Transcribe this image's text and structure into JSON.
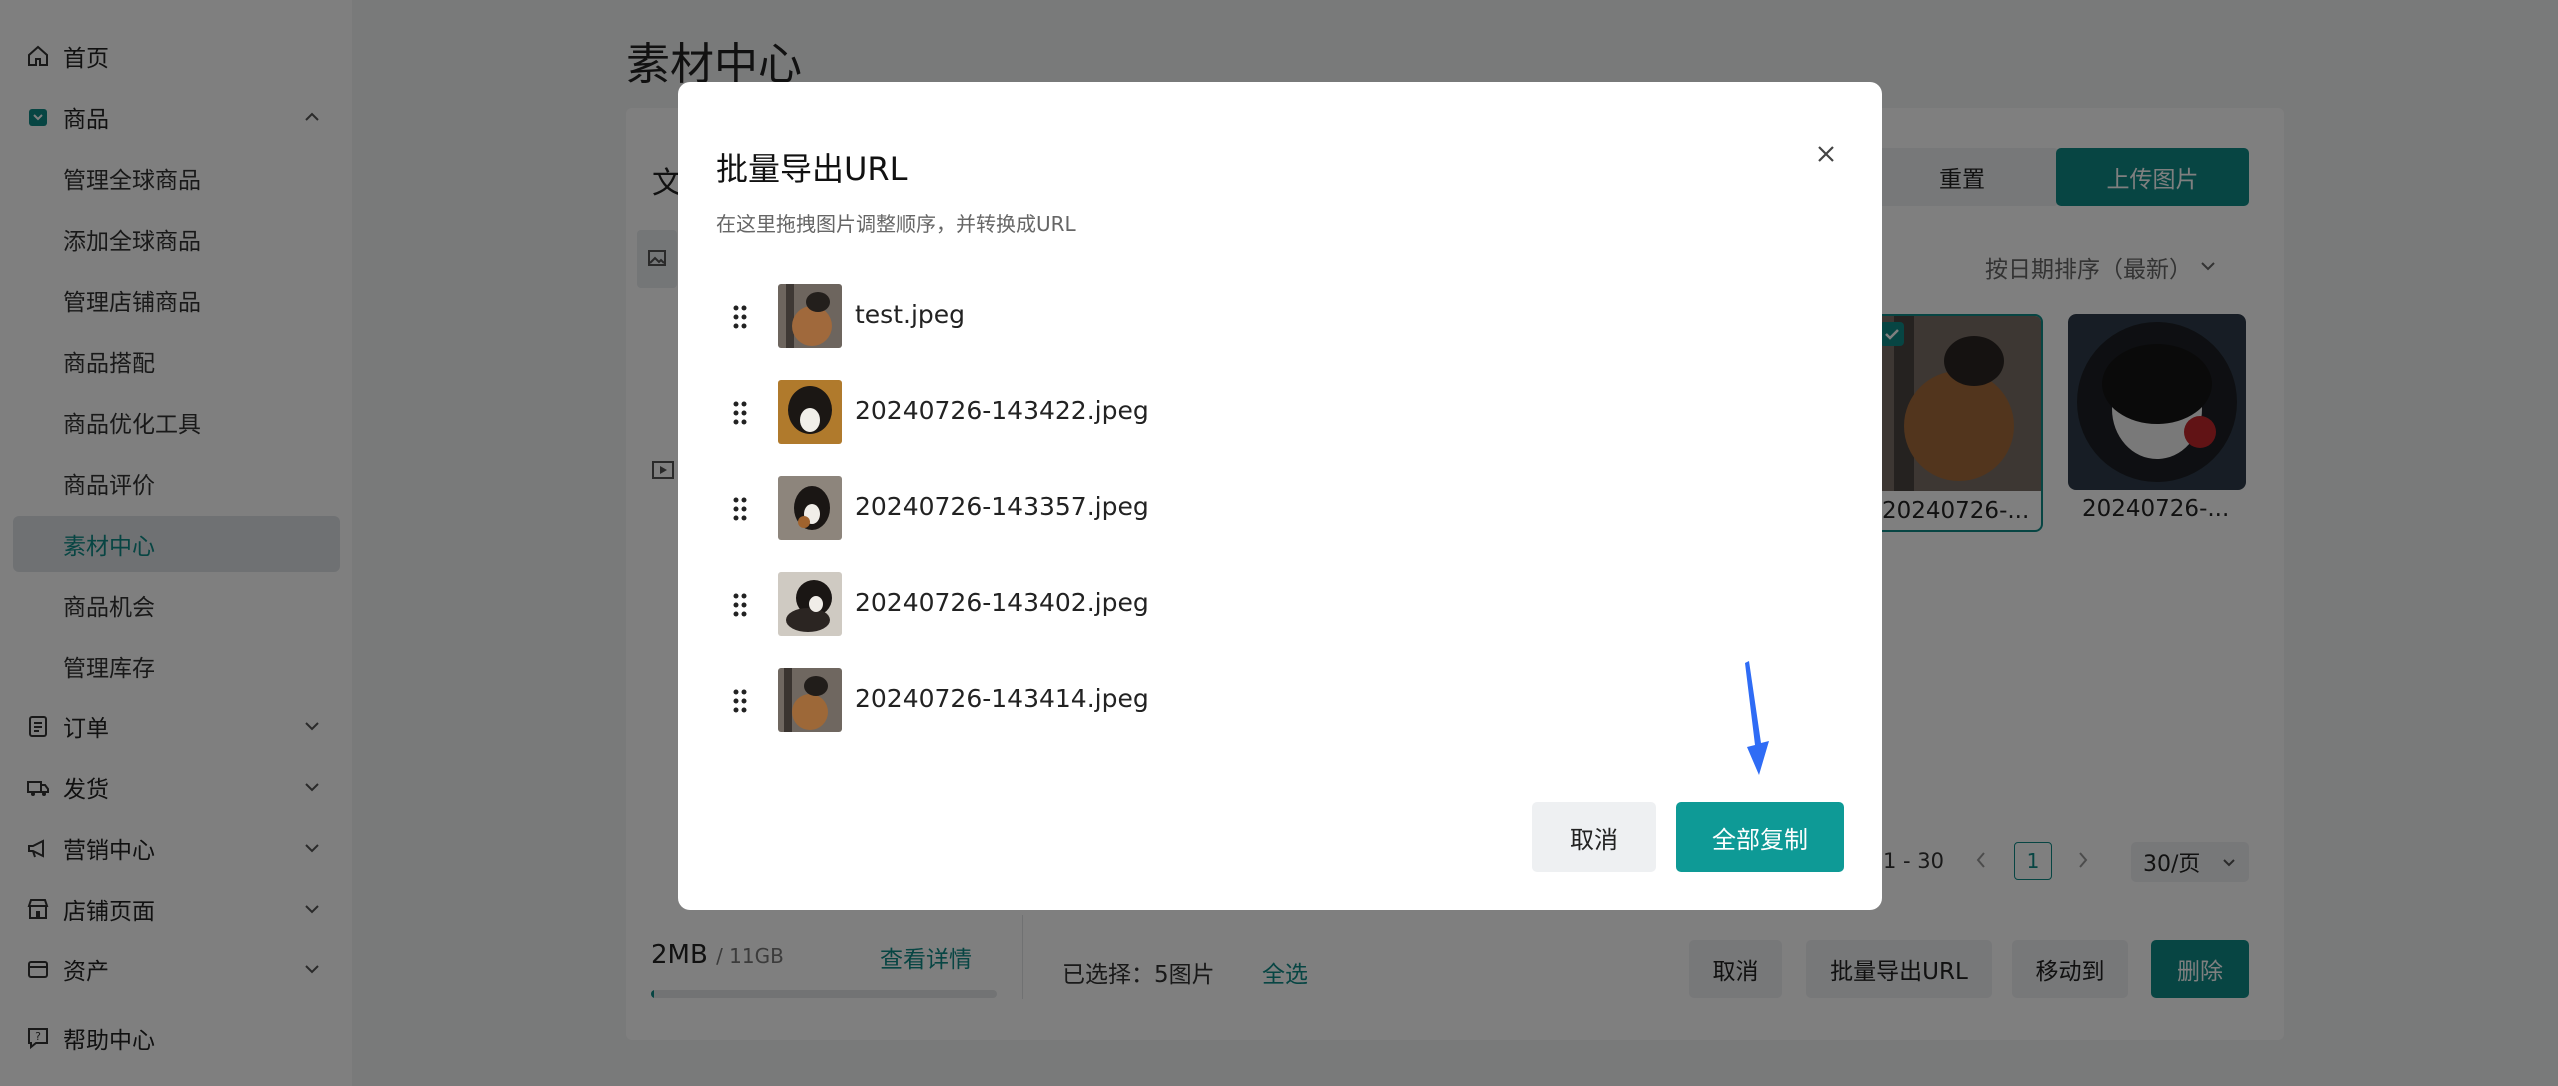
{
  "sidebar": {
    "items": [
      {
        "label": "首页",
        "icon": "home-icon"
      },
      {
        "label": "商品",
        "icon": "product-icon",
        "expanded": true,
        "children": [
          "管理全球商品",
          "添加全球商品",
          "管理店铺商品",
          "商品搭配",
          "商品优化工具",
          "商品评价",
          "素材中心",
          "商品机会",
          "管理库存"
        ]
      },
      {
        "label": "订单",
        "icon": "order-icon"
      },
      {
        "label": "发货",
        "icon": "truck-icon"
      },
      {
        "label": "营销中心",
        "icon": "megaphone-icon"
      },
      {
        "label": "店铺页面",
        "icon": "store-icon"
      },
      {
        "label": "资产",
        "icon": "wallet-icon"
      },
      {
        "label": "帮助中心",
        "icon": "help-icon"
      }
    ],
    "active_child": "素材中心"
  },
  "main": {
    "title": "素材中心",
    "left_panel_letter": "文",
    "reset_label": "重置",
    "upload_label": "上传图片",
    "sort_label": "按日期排序（最新）",
    "thumbs": [
      {
        "caption": "20240726-..."
      },
      {
        "caption": "20240726-..."
      }
    ],
    "pager": {
      "range": "1 - 30",
      "current": "1",
      "per_page": "30/页"
    },
    "storage": {
      "used": "2MB",
      "total": "/ 11GB",
      "link": "查看详情",
      "fraction": 0.002
    },
    "selected_text": "已选择：5图片",
    "select_all": "全选",
    "bottom_actions": {
      "cancel": "取消",
      "export": "批量导出URL",
      "move": "移动到",
      "delete": "删除"
    }
  },
  "modal": {
    "title": "批量导出URL",
    "subtitle": "在这里拖拽图片调整顺序，并转换成URL",
    "files": [
      {
        "name": "test.jpeg"
      },
      {
        "name": "20240726-143422.jpeg"
      },
      {
        "name": "20240726-143357.jpeg"
      },
      {
        "name": "20240726-143402.jpeg"
      },
      {
        "name": "20240726-143414.jpeg"
      }
    ],
    "cancel_label": "取消",
    "copy_all_label": "全部复制"
  },
  "colors": {
    "accent": "#0e8a87",
    "accent_button": "#0e9a96",
    "annotation_arrow": "#2f6cf5"
  }
}
